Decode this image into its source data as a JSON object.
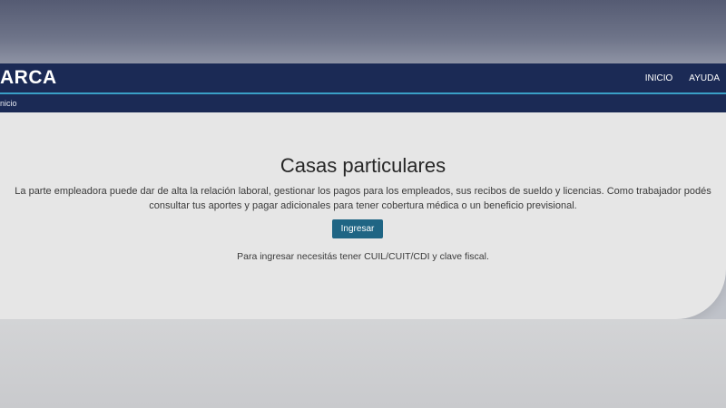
{
  "header": {
    "logo_text": "ARCA",
    "nav_links": [
      "INICIO",
      "AYUDA"
    ]
  },
  "breadcrumb": {
    "current": "nicio"
  },
  "main": {
    "title": "Casas particulares",
    "description": "La parte empleadora puede dar de alta la relación laboral, gestionar los pagos para los empleados, sus recibos de sueldo y licencias. Como trabajador podés consultar tus aportes y pagar adicionales para tener cobertura médica o un beneficio previsional.",
    "login_button_label": "Ingresar",
    "requirement_note": "Para ingresar necesitás tener CUIL/CUIT/CDI y clave fiscal."
  },
  "colors": {
    "navbar": "#1b2a55",
    "accent_line": "#3a9fc6",
    "button": "#1f6584",
    "content_bg": "#e6e6e6"
  }
}
